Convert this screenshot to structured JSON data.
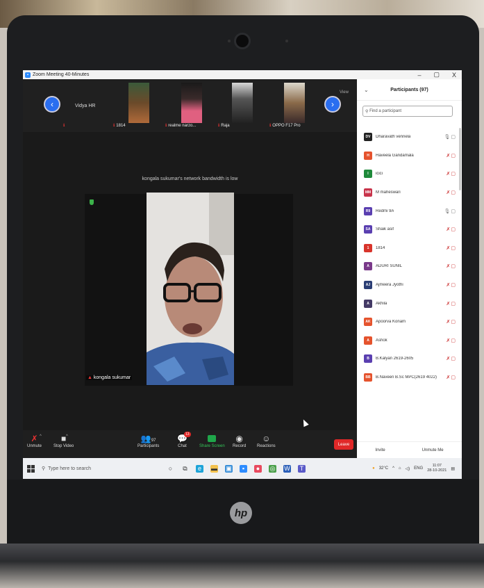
{
  "window": {
    "title": "Zoom Meeting 40-Minutes",
    "minimize": "–",
    "maximize": "▢",
    "close": "X"
  },
  "strip": {
    "host_name": "Vidya HR",
    "view_label": "View",
    "thumbnails": [
      {
        "label": "1814"
      },
      {
        "label": "realme narzo..."
      },
      {
        "label": "Raja"
      },
      {
        "label": "OPPO F17 Pro"
      }
    ],
    "prev_icon": "‹",
    "next_icon": "›"
  },
  "meeting": {
    "network_msg": "kongala sukumar's network bandwidth is low",
    "active_speaker": "kongala sukumar"
  },
  "toolbar": {
    "unmute": "Unmute",
    "stop_video": "Stop Video",
    "participants": "Participants",
    "participants_count": "97",
    "chat": "Chat",
    "chat_badge": "13",
    "share_screen": "Share Screen",
    "record": "Record",
    "reactions": "Reactions",
    "leave": "Leave"
  },
  "panel": {
    "title": "Participants (97)",
    "search_placeholder": "Find a participant",
    "invite": "Invite",
    "unmute_me": "Unmute Me",
    "participants": [
      {
        "initials": "DV",
        "name": "Dharavath vennela",
        "color": "#222222",
        "mic": "on"
      },
      {
        "initials": "H",
        "name": "Haveela Gandamala",
        "color": "#e5532d",
        "mic": "muted"
      },
      {
        "initials": "I",
        "name": "icici",
        "color": "#1f8a3b",
        "mic": "muted"
      },
      {
        "initials": "MM",
        "name": "M maheswari",
        "color": "#c8344b",
        "mic": "muted"
      },
      {
        "initials": "R9",
        "name": "Redmi 9A",
        "color": "#5a3fb0",
        "mic": "on"
      },
      {
        "initials": "SA",
        "name": "Shaik asif",
        "color": "#5a3fb0",
        "mic": "muted"
      },
      {
        "initials": "1",
        "name": "1814",
        "color": "#d8342b",
        "mic": "muted"
      },
      {
        "initials": "A",
        "name": "ADURI SUNIL",
        "color": "#7a3a8a",
        "mic": "muted"
      },
      {
        "initials": "AJ",
        "name": "Ajmeera Jyothi",
        "color": "#2b3e75",
        "mic": "muted"
      },
      {
        "initials": "A",
        "name": "Akhila",
        "color": "#443a66",
        "mic": "muted"
      },
      {
        "initials": "AK",
        "name": "Apoorva Konam",
        "color": "#e5532d",
        "mic": "muted"
      },
      {
        "initials": "A",
        "name": "Ashok",
        "color": "#e5532d",
        "mic": "muted"
      },
      {
        "initials": "B",
        "name": "B.Kalyan 2619-2605",
        "color": "#5a3fb0",
        "mic": "muted"
      },
      {
        "initials": "BB",
        "name": "B.Naveen B.Sc MPC(2619 4022)",
        "color": "#e5532d",
        "mic": "muted"
      }
    ]
  },
  "taskbar": {
    "search_placeholder": "Type here to search",
    "weather": "32°C",
    "language": "ENG",
    "time": "11:07",
    "date": "28-10-2021"
  },
  "laptop": {
    "brand": "hp"
  }
}
